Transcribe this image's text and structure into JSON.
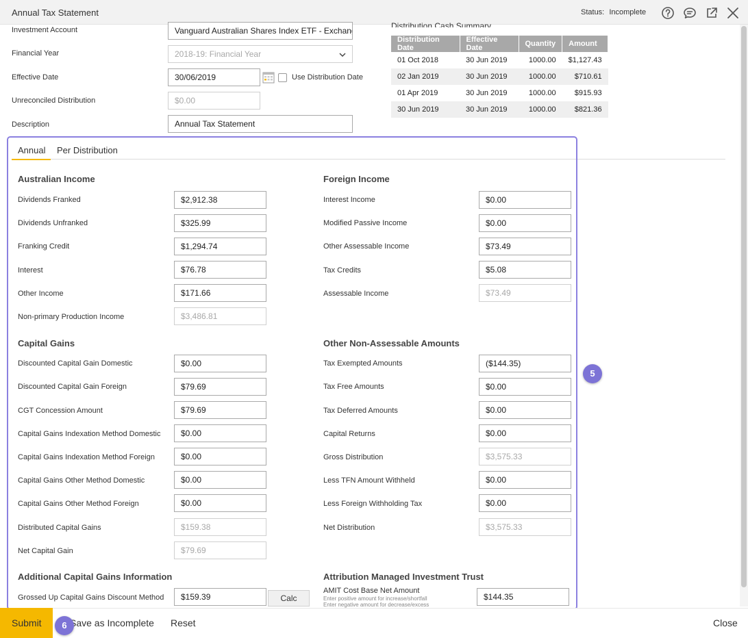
{
  "window": {
    "title": "Annual Tax Statement",
    "status_label": "Status:",
    "status_value": "Incomplete",
    "icons": [
      "help-icon",
      "chat-icon",
      "external-link-icon",
      "close-icon"
    ]
  },
  "details": {
    "investment_account_label": "Investment Account",
    "investment_account_value": "Vanguard Australian Shares Index ETF - Exchang",
    "financial_year_label": "Financial Year",
    "financial_year_value": "2018-19: Financial Year",
    "effective_date_label": "Effective Date",
    "effective_date_value": "30/06/2019",
    "use_distribution_date_label": "Use Distribution Date",
    "unreconciled_label": "Unreconciled Distribution",
    "unreconciled_value": "$0.00",
    "description_label": "Description",
    "description_value": "Annual Tax Statement"
  },
  "distribution_summary": {
    "title": "Distribution Cash Summary",
    "columns": [
      "Distribution Date",
      "Effective Date",
      "Quantity",
      "Amount"
    ],
    "rows": [
      [
        "01 Oct 2018",
        "30 Jun 2019",
        "1000.00",
        "$1,127.43"
      ],
      [
        "02 Jan 2019",
        "30 Jun 2019",
        "1000.00",
        "$710.61"
      ],
      [
        "01 Apr 2019",
        "30 Jun 2019",
        "1000.00",
        "$915.93"
      ],
      [
        "30 Jun 2019",
        "30 Jun 2019",
        "1000.00",
        "$821.36"
      ]
    ]
  },
  "tabs": [
    "Annual",
    "Per Distribution"
  ],
  "australian_income": {
    "heading": "Australian Income",
    "fields": [
      {
        "label": "Dividends Franked",
        "value": "$2,912.38"
      },
      {
        "label": "Dividends Unfranked",
        "value": "$325.99"
      },
      {
        "label": "Franking Credit",
        "value": "$1,294.74"
      },
      {
        "label": "Interest",
        "value": "$76.78"
      },
      {
        "label": "Other Income",
        "value": "$171.66"
      },
      {
        "label": "Non-primary Production Income",
        "value": "$3,486.81"
      }
    ]
  },
  "capital_gains": {
    "heading": "Capital Gains",
    "fields": [
      {
        "label": "Discounted Capital Gain Domestic",
        "value": "$0.00"
      },
      {
        "label": "Discounted Capital Gain Foreign",
        "value": "$79.69"
      },
      {
        "label": "CGT Concession Amount",
        "value": "$79.69"
      },
      {
        "label": "Capital Gains Indexation Method Domestic",
        "value": "$0.00"
      },
      {
        "label": "Capital Gains Indexation Method Foreign",
        "value": "$0.00"
      },
      {
        "label": "Capital Gains Other Method Domestic",
        "value": "$0.00"
      },
      {
        "label": "Capital Gains Other Method Foreign",
        "value": "$0.00"
      },
      {
        "label": "Distributed Capital Gains",
        "value": "$159.38"
      },
      {
        "label": "Net Capital Gain",
        "value": "$79.69"
      }
    ]
  },
  "additional_cg": {
    "heading": "Additional Capital Gains Information",
    "label": "Grossed Up Capital Gains Discount Method",
    "value": "$159.39",
    "calc_label": "Calc"
  },
  "foreign_income": {
    "heading": "Foreign Income",
    "fields": [
      {
        "label": "Interest Income",
        "value": "$0.00"
      },
      {
        "label": "Modified Passive Income",
        "value": "$0.00"
      },
      {
        "label": "Other Assessable Income",
        "value": "$73.49"
      },
      {
        "label": "Tax Credits",
        "value": "$5.08"
      },
      {
        "label": "Assessable Income",
        "value": "$73.49"
      }
    ]
  },
  "non_assessable": {
    "heading": "Other Non-Assessable Amounts",
    "fields": [
      {
        "label": "Tax Exempted Amounts",
        "value": "($144.35)"
      },
      {
        "label": "Tax Free Amounts",
        "value": "$0.00"
      },
      {
        "label": "Tax Deferred Amounts",
        "value": "$0.00"
      },
      {
        "label": "Capital Returns",
        "value": "$0.00"
      },
      {
        "label": "Gross Distribution",
        "value": "$3,575.33"
      },
      {
        "label": "Less TFN Amount Withheld",
        "value": "$0.00"
      },
      {
        "label": "Less Foreign Withholding Tax",
        "value": "$0.00"
      },
      {
        "label": "Net Distribution",
        "value": "$3,575.33"
      }
    ]
  },
  "amit": {
    "heading": "Attribution Managed Investment Trust",
    "label": "AMIT Cost Base Net Amount",
    "hint1": "Enter positive amount for increase/shortfall",
    "hint2": "Enter negative amount for decrease/excess",
    "value": "$144.35"
  },
  "badges": {
    "panel": "5",
    "footer": "6"
  },
  "footer": {
    "submit": "Submit",
    "save_incomplete": "Save as Incomplete",
    "reset": "Reset",
    "close": "Close"
  },
  "colors": {
    "accent": "#f5b800",
    "highlight": "#8b80e0",
    "badge": "#7d73d6",
    "table_header": "#a8a8a8"
  }
}
